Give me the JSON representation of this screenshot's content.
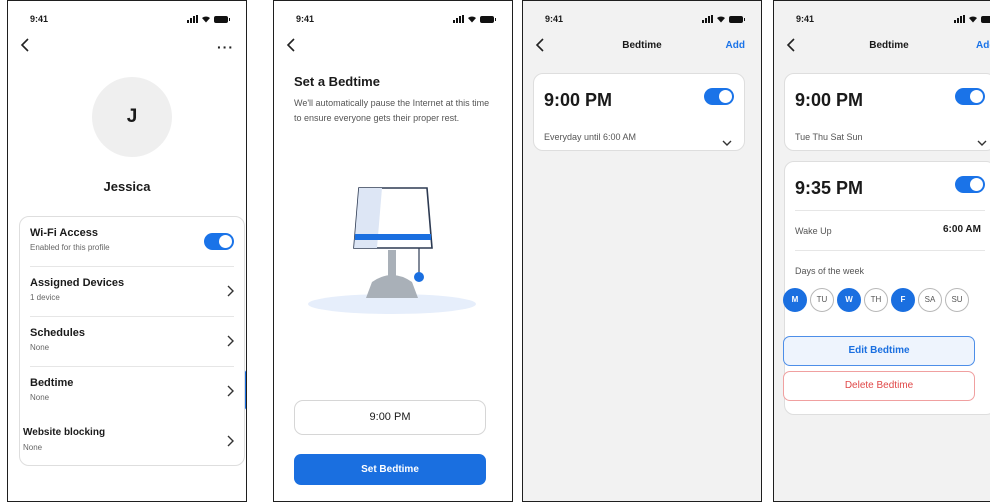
{
  "status": {
    "time": "9:41"
  },
  "colors": {
    "accent": "#1a6fe0",
    "danger": "#e04848",
    "highlight": "#dbe8fb"
  },
  "profile": {
    "avatar_initial": "J",
    "name": "Jessica",
    "more_label": "···",
    "menu": [
      {
        "title": "Wi-Fi Access",
        "subtitle": "Enabled for this profile",
        "toggle_on": true
      },
      {
        "title": "Assigned Devices",
        "subtitle": "1 device"
      },
      {
        "title": "Schedules",
        "subtitle": "None"
      },
      {
        "title": "Bedtime",
        "subtitle": "None",
        "highlighted": true
      },
      {
        "title": "Website blocking",
        "subtitle": "None"
      }
    ]
  },
  "setup": {
    "heading": "Set a Bedtime",
    "description": "We'll automatically pause the Internet at this time to ensure everyone gets their proper rest.",
    "time_value": "9:00 PM",
    "button_label": "Set Bedtime",
    "illustration": "lamp-illustration"
  },
  "list_single": {
    "nav_title": "Bedtime",
    "nav_action": "Add",
    "items": [
      {
        "time": "9:00 PM",
        "summary": "Everyday until 6:00 AM",
        "toggle_on": true
      }
    ]
  },
  "list_detail": {
    "nav_title": "Bedtime",
    "nav_action": "Add",
    "first": {
      "time": "9:00 PM",
      "summary": "Tue Thu Sat Sun",
      "toggle_on": true
    },
    "second": {
      "time": "9:35 PM",
      "toggle_on": true,
      "wake_label": "Wake Up",
      "wake_value": "6:00 AM",
      "days_label": "Days of the week",
      "days": [
        {
          "label": "M",
          "on": true
        },
        {
          "label": "TU",
          "on": false
        },
        {
          "label": "W",
          "on": true
        },
        {
          "label": "TH",
          "on": false
        },
        {
          "label": "F",
          "on": true
        },
        {
          "label": "SA",
          "on": false
        },
        {
          "label": "SU",
          "on": false
        }
      ],
      "edit_label": "Edit Bedtime",
      "delete_label": "Delete Bedtime"
    }
  }
}
